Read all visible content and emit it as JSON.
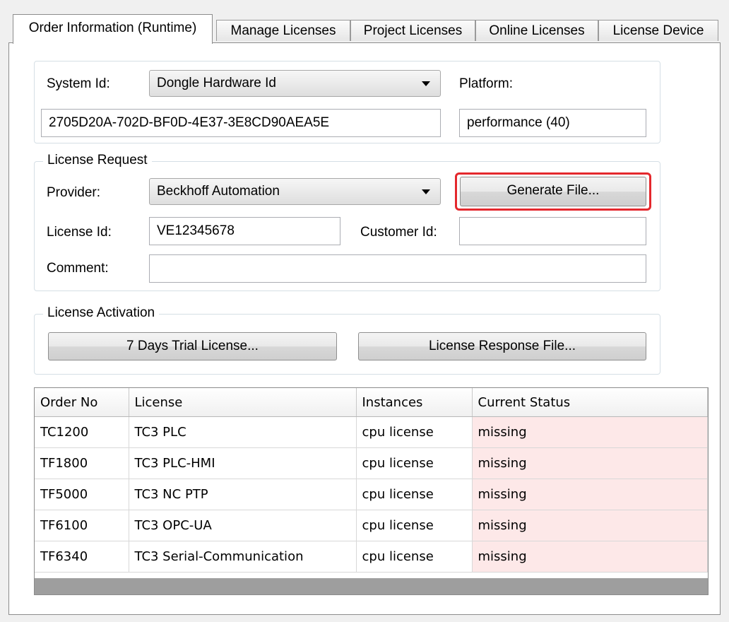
{
  "tabs": [
    {
      "label": "Order Information (Runtime)"
    },
    {
      "label": "Manage Licenses"
    },
    {
      "label": "Project Licenses"
    },
    {
      "label": "Online Licenses"
    },
    {
      "label": "License Device"
    }
  ],
  "system": {
    "system_id_label": "System Id:",
    "system_id_type": "Dongle Hardware Id",
    "system_id_value": "2705D20A-702D-BF0D-4E37-3E8CD90AEA5E",
    "platform_label": "Platform:",
    "platform_value": "performance (40)"
  },
  "license_request": {
    "legend": "License Request",
    "provider_label": "Provider:",
    "provider_value": "Beckhoff Automation",
    "generate_button": "Generate File...",
    "license_id_label": "License Id:",
    "license_id_value": "VE12345678",
    "customer_id_label": "Customer Id:",
    "customer_id_value": "",
    "comment_label": "Comment:",
    "comment_value": ""
  },
  "license_activation": {
    "legend": "License Activation",
    "trial_button": "7 Days Trial License...",
    "response_button": "License Response File..."
  },
  "table": {
    "headers": [
      "Order No",
      "License",
      "Instances",
      "Current Status"
    ],
    "rows": [
      [
        "TC1200",
        "TC3 PLC",
        "cpu license",
        "missing"
      ],
      [
        "TF1800",
        "TC3 PLC-HMI",
        "cpu license",
        "missing"
      ],
      [
        "TF5000",
        "TC3 NC PTP",
        "cpu license",
        "missing"
      ],
      [
        "TF6100",
        "TC3 OPC-UA",
        "cpu license",
        "missing"
      ],
      [
        "TF6340",
        "TC3 Serial-Communication",
        "cpu license",
        "missing"
      ]
    ]
  },
  "colors": {
    "highlight": "#e4282d",
    "missing_status_bg": "#fde8e8"
  }
}
